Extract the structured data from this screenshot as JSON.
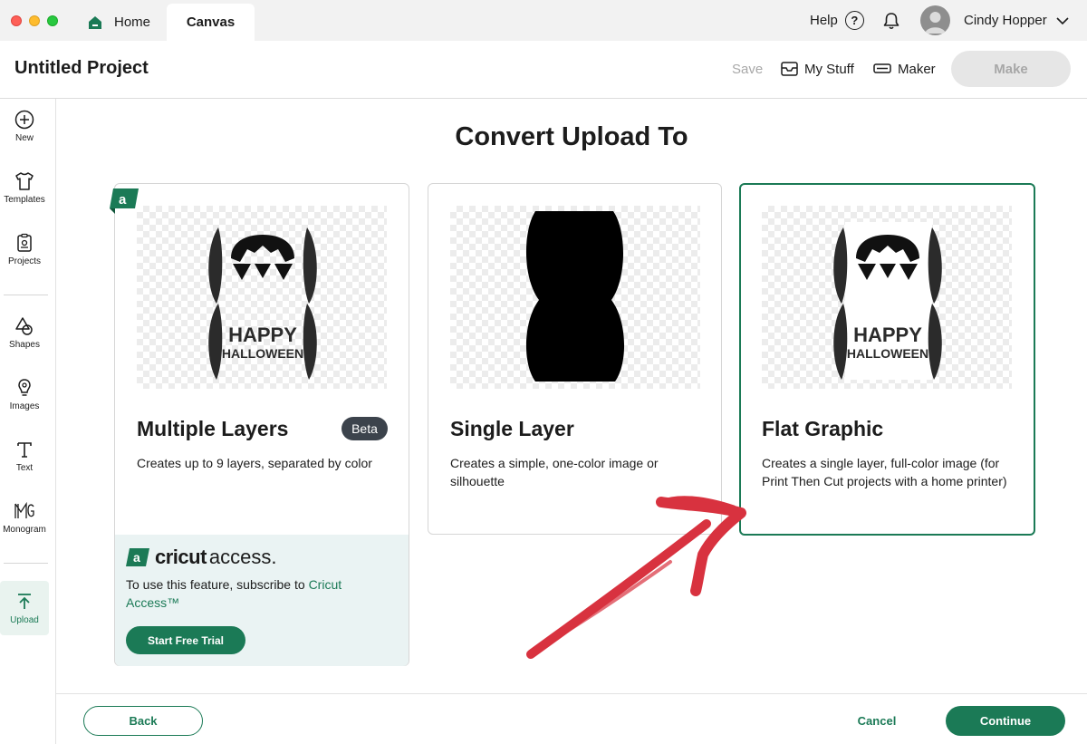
{
  "colors": {
    "accent": "#1b7a56",
    "arrow": "#d8323f",
    "beta_badge": "#3c434c",
    "access_panel_bg": "#eaf3f3",
    "make_disabled_bg": "#e6e6e6"
  },
  "titlebar": {
    "tabs": [
      {
        "label": "Home",
        "icon": "home-icon"
      },
      {
        "label": "Canvas"
      }
    ],
    "help_label": "Help",
    "help_icon": "question-circle-icon",
    "notification_icon": "bell-icon",
    "user_name": "Cindy Hopper",
    "user_menu_icon": "chevron-down-icon"
  },
  "header": {
    "project_title": "Untitled Project",
    "save_label": "Save",
    "my_stuff_label": "My Stuff",
    "my_stuff_icon": "inbox-icon",
    "maker_label": "Maker",
    "maker_icon": "machine-icon",
    "make_label": "Make"
  },
  "sidebar": {
    "items": [
      {
        "label": "New",
        "icon": "plus-circle-icon"
      },
      {
        "label": "Templates",
        "icon": "shirt-icon"
      },
      {
        "label": "Projects",
        "icon": "clipboard-icon"
      },
      {
        "label": "Shapes",
        "icon": "shapes-icon"
      },
      {
        "label": "Images",
        "icon": "bulb-icon"
      },
      {
        "label": "Text",
        "icon": "text-t-icon"
      },
      {
        "label": "Monogram",
        "icon": "monogram-icon"
      },
      {
        "label": "Upload",
        "icon": "upload-arrow-icon",
        "active": true
      }
    ]
  },
  "main": {
    "title": "Convert Upload To",
    "cards": [
      {
        "title": "Multiple Layers",
        "badge": "Beta",
        "description": "Creates up to 9 layers, separated by color",
        "preview": "happy-halloween-bat-design",
        "access_badge_icon": "cricut-access-a-icon"
      },
      {
        "title": "Single Layer",
        "description": "Creates a simple, one-color image or silhouette",
        "preview": "black-silhouette"
      },
      {
        "title": "Flat Graphic",
        "description": "Creates a single layer, full-color image (for Print Then Cut projects with a home printer)",
        "preview": "happy-halloween-flat",
        "selected": true
      }
    ],
    "access": {
      "logo_brand": "cricut",
      "logo_word": "access.",
      "text_before": "To use this feature, subscribe to ",
      "link_text": "Cricut Access™",
      "trial_label": "Start Free Trial"
    },
    "preview_art_text": {
      "line1": "HAPPY",
      "line2": "HALLOWEEN"
    }
  },
  "footer": {
    "back_label": "Back",
    "cancel_label": "Cancel",
    "continue_label": "Continue"
  }
}
